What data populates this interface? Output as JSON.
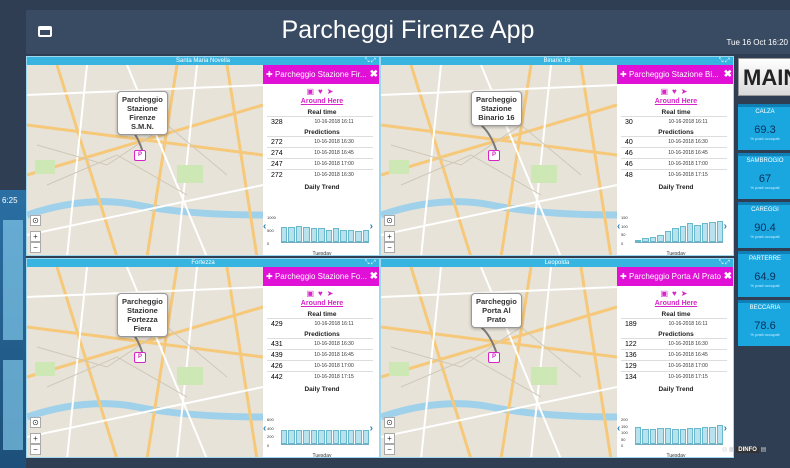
{
  "app": {
    "title": "Parcheggi Firenze App",
    "clock": "Tue 16 Oct 16:20"
  },
  "background": {
    "clock": "6:25"
  },
  "main_button": "MAIN",
  "panels": [
    {
      "window_title": "Santa Maria Novella",
      "header": "Parcheggio Stazione Fir...",
      "map_label": [
        "Parcheggio",
        "Stazione",
        "Firenze",
        "S.M.N."
      ],
      "around": "Around Here",
      "realtime_label": "Real time",
      "realtime": {
        "value": "328",
        "time": "10-16-2018 16:11"
      },
      "predictions_label": "Predictions",
      "predictions": [
        {
          "value": "272",
          "time": "10-16-2018 16:30"
        },
        {
          "value": "274",
          "time": "10-16-2018 16:45"
        },
        {
          "value": "247",
          "time": "10-16-2018 17:00"
        },
        {
          "value": "272",
          "time": "10-16-2018 16:30"
        }
      ],
      "trend_label": "Daily Trend",
      "trend_axis": [
        "1000",
        "500",
        "0"
      ],
      "trend": [
        0.6,
        0.6,
        0.65,
        0.6,
        0.55,
        0.55,
        0.5,
        0.55,
        0.5,
        0.5,
        0.45,
        0.5
      ],
      "day": "Tuesday"
    },
    {
      "window_title": "Binario 16",
      "header": "Parcheggio Stazione Bi...",
      "map_label": [
        "Parcheggio",
        "Stazione",
        "Binario 16"
      ],
      "around": "Around Here",
      "realtime_label": "Real time",
      "realtime": {
        "value": "30",
        "time": "10-16-2018 16:11"
      },
      "predictions_label": "Predictions",
      "predictions": [
        {
          "value": "40",
          "time": "10-16-2018 16:30"
        },
        {
          "value": "46",
          "time": "10-16-2018 16:45"
        },
        {
          "value": "46",
          "time": "10-16-2018 17:00"
        },
        {
          "value": "48",
          "time": "10-16-2018 17:15"
        }
      ],
      "trend_label": "Daily Trend",
      "trend_axis": [
        "150",
        "100",
        "50",
        "0"
      ],
      "trend": [
        0.1,
        0.15,
        0.2,
        0.3,
        0.45,
        0.55,
        0.65,
        0.75,
        0.7,
        0.75,
        0.8,
        0.85
      ],
      "day": "Tuesday"
    },
    {
      "window_title": "Fortezza",
      "header": "Parcheggio Stazione Fo...",
      "map_label": [
        "Parcheggio",
        "Stazione",
        "Fortezza",
        "Fiera"
      ],
      "around": "Around Here",
      "realtime_label": "Real time",
      "realtime": {
        "value": "429",
        "time": "10-16-2018 16:11"
      },
      "predictions_label": "Predictions",
      "predictions": [
        {
          "value": "431",
          "time": "10-16-2018 16:30"
        },
        {
          "value": "439",
          "time": "10-16-2018 16:45"
        },
        {
          "value": "426",
          "time": "10-16-2018 17:00"
        },
        {
          "value": "442",
          "time": "10-16-2018 17:15"
        }
      ],
      "trend_label": "Daily Trend",
      "trend_axis": [
        "600",
        "400",
        "200",
        "0"
      ],
      "trend": [
        0.55,
        0.55,
        0.55,
        0.55,
        0.55,
        0.55,
        0.55,
        0.55,
        0.55,
        0.55,
        0.55,
        0.55
      ],
      "day": "Tuesday"
    },
    {
      "window_title": "Leopolda",
      "header": "Parcheggio Porta Al Prato",
      "map_label": [
        "Parcheggio",
        "Porta Al",
        "Prato"
      ],
      "around": "Around Here",
      "realtime_label": "Real time",
      "realtime": {
        "value": "189",
        "time": "10-16-2018 16:11"
      },
      "predictions_label": "Predictions",
      "predictions": [
        {
          "value": "122",
          "time": "10-16-2018 16:30"
        },
        {
          "value": "136",
          "time": "10-16-2018 16:45"
        },
        {
          "value": "129",
          "time": "10-16-2018 17:00"
        },
        {
          "value": "134",
          "time": "10-16-2018 17:15"
        }
      ],
      "trend_label": "Daily Trend",
      "trend_axis": [
        "200",
        "150",
        "100",
        "50",
        "0"
      ],
      "trend": [
        0.7,
        0.6,
        0.6,
        0.65,
        0.65,
        0.6,
        0.6,
        0.65,
        0.65,
        0.7,
        0.7,
        0.75
      ],
      "day": "Tuesday"
    }
  ],
  "cards": [
    {
      "name": "CALZA",
      "value": "69.3",
      "sub": "% posti occupati"
    },
    {
      "name": "SAMBROGIO",
      "value": "67",
      "sub": "% posti occupati"
    },
    {
      "name": "CAREGGI",
      "value": "90.4",
      "sub": "% posti occupati"
    },
    {
      "name": "PARTERRE",
      "value": "64.9",
      "sub": "% posti occupati"
    },
    {
      "name": "BECCARIA",
      "value": "78.6",
      "sub": "% posti occupati"
    }
  ],
  "footer": {
    "logo": "DINFO"
  }
}
